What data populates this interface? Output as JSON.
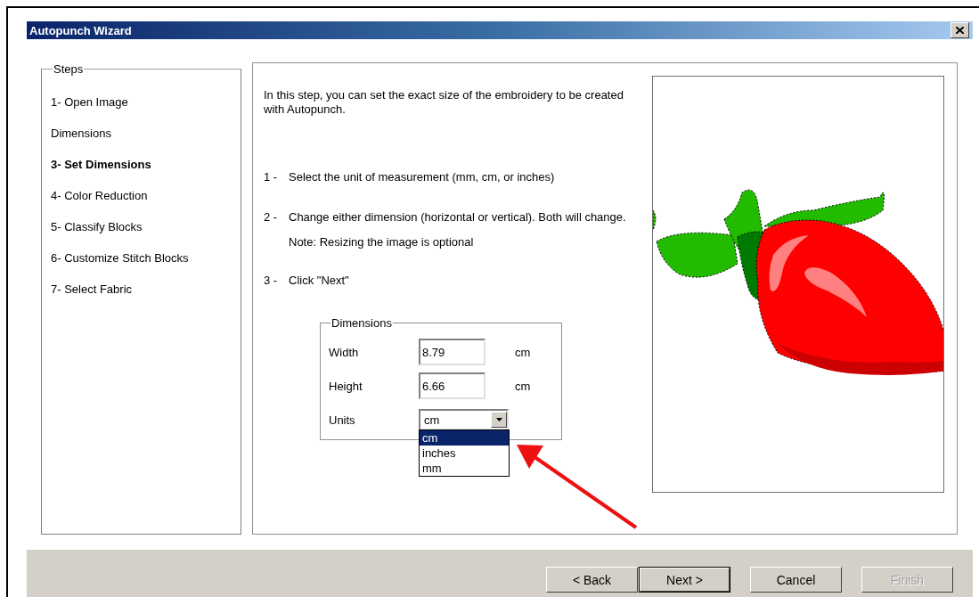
{
  "window": {
    "title": "Autopunch Wizard"
  },
  "steps": {
    "label": "Steps",
    "items": [
      {
        "label": "1- Open Image",
        "selected": false
      },
      {
        "label": "Dimensions",
        "selected": false
      },
      {
        "label": "3- Set Dimensions",
        "selected": true
      },
      {
        "label": "4- Color Reduction",
        "selected": false
      },
      {
        "label": "5- Classify Blocks",
        "selected": false
      },
      {
        "label": "6- Customize Stitch Blocks",
        "selected": false
      },
      {
        "label": "7- Select Fabric",
        "selected": false
      }
    ]
  },
  "instructions": {
    "intro": "In this step, you can set the exact size of the embroidery to be created with Autopunch.",
    "items": [
      {
        "number": "1 -",
        "text": "Select the unit of measurement (mm, cm, or inches)"
      },
      {
        "number": "2 -",
        "text": "Change either dimension (horizontal or vertical). Both will change.",
        "note": "Note: Resizing the image is optional"
      },
      {
        "number": "3 -",
        "text": "Click \"Next\""
      }
    ]
  },
  "dimensions": {
    "label": "Dimensions",
    "fields": [
      {
        "kind": "text",
        "label": "Width",
        "value": "8.79",
        "unit": "cm"
      },
      {
        "kind": "text",
        "label": "Height",
        "value": "6.66",
        "unit": "cm"
      },
      {
        "kind": "dropdown",
        "label": "Units",
        "value": "cm",
        "expanded": true,
        "options": [
          {
            "label": "cm",
            "selected": true
          },
          {
            "label": "inches",
            "selected": false
          },
          {
            "label": "mm",
            "selected": false
          }
        ]
      }
    ]
  },
  "buttons": [
    {
      "label": "< Back",
      "default": false,
      "disabled": false
    },
    {
      "label": "Next >",
      "default": true,
      "disabled": false
    },
    {
      "label": "Cancel",
      "default": false,
      "disabled": false
    },
    {
      "label": "Finish",
      "default": false,
      "disabled": true
    }
  ]
}
